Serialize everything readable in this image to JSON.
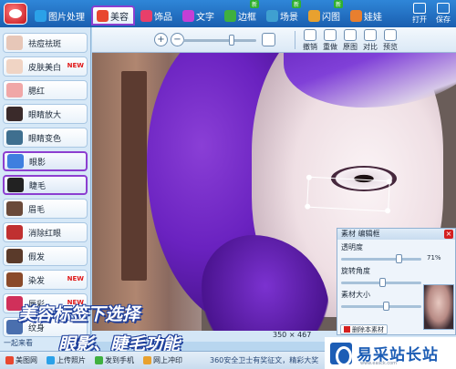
{
  "header": {
    "tabs": [
      {
        "label": "图片处理",
        "color": "#2ba1e8",
        "active": false,
        "new": false
      },
      {
        "label": "美容",
        "color": "#e8472f",
        "active": true,
        "new": false
      },
      {
        "label": "饰品",
        "color": "#e83f6a",
        "active": false,
        "new": false
      },
      {
        "label": "文字",
        "color": "#c43fd6",
        "active": false,
        "new": false
      },
      {
        "label": "边框",
        "color": "#3fb03f",
        "active": false,
        "new": true,
        "new_label": "新"
      },
      {
        "label": "场景",
        "color": "#3fa0d0",
        "active": false,
        "new": true,
        "new_label": "新"
      },
      {
        "label": "闪图",
        "color": "#e8a12f",
        "active": false,
        "new": true,
        "new_label": "新"
      },
      {
        "label": "娃娃",
        "color": "#e87f2f",
        "active": false,
        "new": false
      }
    ],
    "open_label": "打开",
    "save_label": "保存"
  },
  "sidebar": {
    "items": [
      {
        "label": "祛痘祛斑",
        "new": false,
        "thumb_color": "#e7c7b8",
        "highlight": false
      },
      {
        "label": "皮肤美白",
        "new": true,
        "new_label": "NEW",
        "thumb_color": "#f0d4c4",
        "highlight": false
      },
      {
        "label": "腮红",
        "new": false,
        "thumb_color": "#f0a7a7",
        "highlight": false
      },
      {
        "label": "眼睛放大",
        "new": false,
        "thumb_color": "#3a2a2a",
        "highlight": false
      },
      {
        "label": "眼睛变色",
        "new": false,
        "thumb_color": "#3f6f8f",
        "highlight": false
      },
      {
        "label": "眼影",
        "new": false,
        "thumb_color": "#3f7fdf",
        "highlight": true
      },
      {
        "label": "睫毛",
        "new": false,
        "thumb_color": "#222222",
        "highlight": true
      },
      {
        "label": "眉毛",
        "new": false,
        "thumb_color": "#6a4a3a",
        "highlight": false
      },
      {
        "label": "消除红眼",
        "new": false,
        "thumb_color": "#c03030",
        "highlight": false
      },
      {
        "label": "假发",
        "new": false,
        "thumb_color": "#5a3a2a",
        "highlight": false
      },
      {
        "label": "染发",
        "new": true,
        "new_label": "NEW",
        "thumb_color": "#8a4a2a",
        "highlight": false
      },
      {
        "label": "唇彩",
        "new": true,
        "new_label": "NEW",
        "thumb_color": "#d0305a",
        "highlight": false
      },
      {
        "label": "纹身",
        "new": false,
        "thumb_color": "#4a6fae",
        "highlight": false
      }
    ],
    "bottom_text": "一起来看"
  },
  "toolbar": {
    "zoom_in": "+",
    "zoom_out": "−",
    "tools": [
      "撤销",
      "重做",
      "原图",
      "对比",
      "预览"
    ]
  },
  "canvas": {
    "size_text": "350 × 467"
  },
  "panel": {
    "title": "素材 编辑框",
    "close_label": "×",
    "rows": [
      {
        "label": "透明度",
        "value": "71%",
        "fraction": 0.71
      },
      {
        "label": "旋转角度",
        "value": "",
        "fraction": 0.5
      },
      {
        "label": "素材大小",
        "value": "",
        "fraction": 0.55
      }
    ],
    "delete_label": "删除本素材"
  },
  "caption": {
    "line1": "美容标签下选择",
    "line2": "眼影、睫毛功能"
  },
  "statusbar": {
    "items": [
      {
        "label": "美图网",
        "color": "#e8472f"
      },
      {
        "label": "上传照片",
        "color": "#2ba1e8"
      },
      {
        "label": "发到手机",
        "color": "#3fb03f"
      },
      {
        "label": "网上冲印",
        "color": "#e8a12f"
      }
    ],
    "security_text": "360安全卫士有奖征文，精彩大奖"
  },
  "watermark": {
    "name": "易采站长站",
    "url": "www.easck.com"
  }
}
